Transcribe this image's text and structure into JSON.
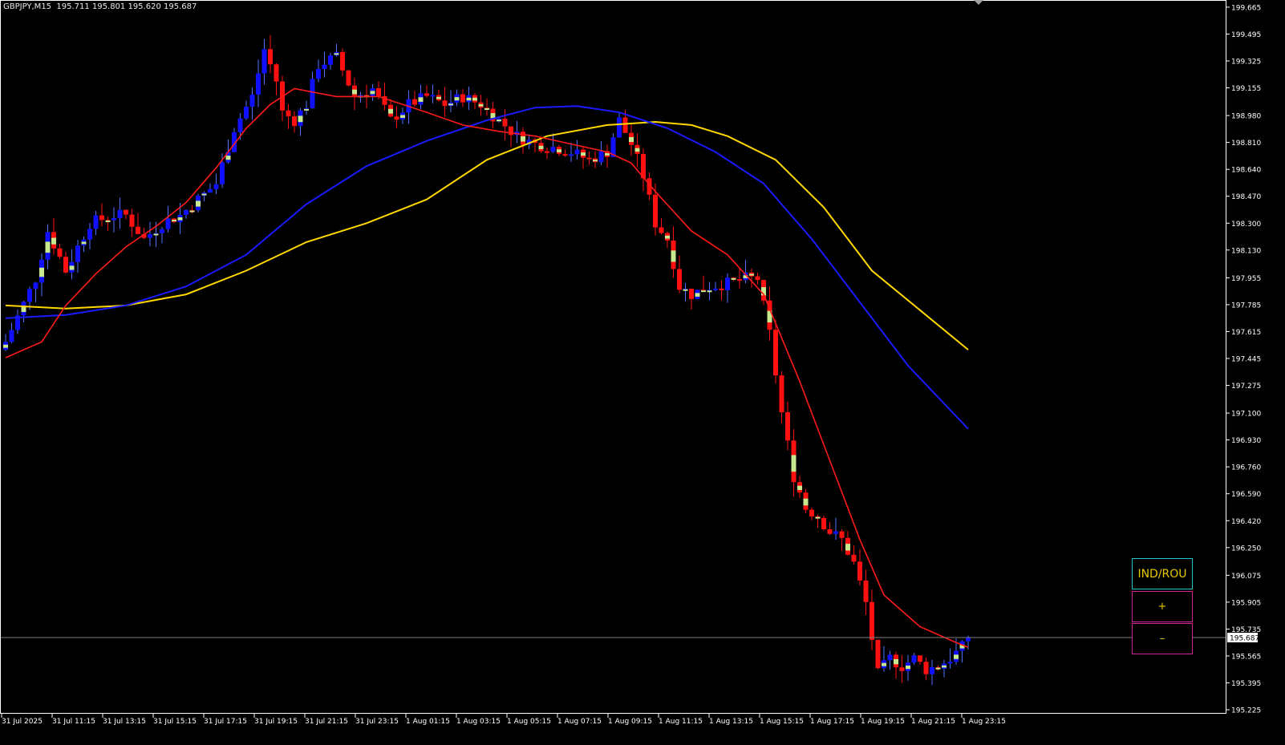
{
  "header": {
    "symbol_info": "GBPJPY,M15  195.711 195.801 195.620 195.687"
  },
  "panel": {
    "ind_label": "IND/ROU",
    "plus_label": "+",
    "minus_label": "–"
  },
  "colors": {
    "background": "#000000",
    "bull": "#1010ff",
    "bear": "#ff1010",
    "doji": "#c8e890",
    "wick": "#4a70ff",
    "ma_fast": "#ff1a1a",
    "ma_mid": "#1a1aff",
    "ma_slow": "#ffd800",
    "axis": "#ffffff",
    "price_line": "#808080"
  },
  "chart_data": {
    "type": "candlestick",
    "symbol": "GBPJPY",
    "timeframe": "M15",
    "ylim": [
      195.2,
      199.7
    ],
    "y_ticks": [
      "199.665",
      "199.495",
      "199.325",
      "199.155",
      "198.980",
      "198.810",
      "198.640",
      "198.470",
      "198.300",
      "198.130",
      "197.955",
      "197.785",
      "197.615",
      "197.445",
      "197.275",
      "197.100",
      "196.930",
      "196.760",
      "196.590",
      "196.420",
      "196.250",
      "196.075",
      "195.905",
      "195.735",
      "195.565",
      "195.395",
      "195.225"
    ],
    "x_ticks": [
      "31 Jul 2025",
      "31 Jul 11:15",
      "31 Jul 13:15",
      "31 Jul 15:15",
      "31 Jul 17:15",
      "31 Jul 19:15",
      "31 Jul 21:15",
      "31 Jul 23:15",
      "1 Aug 01:15",
      "1 Aug 03:15",
      "1 Aug 05:15",
      "1 Aug 07:15",
      "1 Aug 09:15",
      "1 Aug 11:15",
      "1 Aug 13:15",
      "1 Aug 15:15",
      "1 Aug 17:15",
      "1 Aug 19:15",
      "1 Aug 21:15",
      "1 Aug 23:15"
    ],
    "current_price": "195.687",
    "close_path": [
      [
        0,
        197.55
      ],
      [
        5,
        197.95
      ],
      [
        7,
        198.25
      ],
      [
        10,
        198.0
      ],
      [
        14,
        198.3
      ],
      [
        18,
        198.35
      ],
      [
        20,
        198.35
      ],
      [
        23,
        198.2
      ],
      [
        26,
        198.3
      ],
      [
        29,
        198.35
      ],
      [
        32,
        198.45
      ],
      [
        35,
        198.55
      ],
      [
        38,
        198.9
      ],
      [
        41,
        199.1
      ],
      [
        43,
        199.4
      ],
      [
        45,
        199.2
      ],
      [
        46,
        199.0
      ],
      [
        48,
        198.95
      ],
      [
        50,
        199.05
      ],
      [
        52,
        199.3
      ],
      [
        55,
        199.35
      ],
      [
        58,
        199.1
      ],
      [
        61,
        199.15
      ],
      [
        64,
        198.95
      ],
      [
        67,
        199.05
      ],
      [
        70,
        199.1
      ],
      [
        73,
        199.05
      ],
      [
        76,
        199.1
      ],
      [
        79,
        199.05
      ],
      [
        82,
        198.95
      ],
      [
        85,
        198.85
      ],
      [
        88,
        198.8
      ],
      [
        91,
        198.78
      ],
      [
        94,
        198.75
      ],
      [
        97,
        198.7
      ],
      [
        100,
        198.75
      ],
      [
        102,
        198.95
      ],
      [
        104,
        198.8
      ],
      [
        106,
        198.6
      ],
      [
        108,
        198.3
      ],
      [
        110,
        198.2
      ],
      [
        112,
        197.9
      ],
      [
        114,
        197.85
      ],
      [
        117,
        197.9
      ],
      [
        120,
        197.92
      ],
      [
        123,
        197.95
      ],
      [
        125,
        197.95
      ],
      [
        127,
        197.6
      ],
      [
        129,
        197.1
      ],
      [
        131,
        196.7
      ],
      [
        133,
        196.5
      ],
      [
        135,
        196.45
      ],
      [
        137,
        196.35
      ],
      [
        139,
        196.3
      ],
      [
        141,
        196.15
      ],
      [
        143,
        195.9
      ],
      [
        145,
        195.45
      ],
      [
        147,
        195.55
      ],
      [
        149,
        195.5
      ],
      [
        151,
        195.55
      ],
      [
        153,
        195.48
      ],
      [
        155,
        195.5
      ],
      [
        157,
        195.55
      ],
      [
        159,
        195.62
      ],
      [
        160,
        195.69
      ]
    ],
    "ma_fast_path": [
      [
        0,
        197.45
      ],
      [
        6,
        197.55
      ],
      [
        10,
        197.78
      ],
      [
        15,
        197.98
      ],
      [
        20,
        198.15
      ],
      [
        25,
        198.28
      ],
      [
        30,
        198.43
      ],
      [
        35,
        198.65
      ],
      [
        40,
        198.9
      ],
      [
        44,
        199.05
      ],
      [
        48,
        199.15
      ],
      [
        55,
        199.1
      ],
      [
        62,
        199.1
      ],
      [
        70,
        199.0
      ],
      [
        76,
        198.92
      ],
      [
        82,
        198.88
      ],
      [
        88,
        198.85
      ],
      [
        94,
        198.8
      ],
      [
        100,
        198.75
      ],
      [
        104,
        198.68
      ],
      [
        108,
        198.5
      ],
      [
        114,
        198.25
      ],
      [
        120,
        198.1
      ],
      [
        126,
        197.85
      ],
      [
        132,
        197.3
      ],
      [
        138,
        196.7
      ],
      [
        142,
        196.3
      ],
      [
        146,
        195.95
      ],
      [
        152,
        195.75
      ],
      [
        158,
        195.65
      ],
      [
        160,
        195.62
      ]
    ],
    "ma_mid_path": [
      [
        0,
        197.7
      ],
      [
        10,
        197.72
      ],
      [
        20,
        197.78
      ],
      [
        30,
        197.9
      ],
      [
        40,
        198.1
      ],
      [
        50,
        198.42
      ],
      [
        60,
        198.66
      ],
      [
        70,
        198.82
      ],
      [
        80,
        198.95
      ],
      [
        88,
        199.03
      ],
      [
        95,
        199.04
      ],
      [
        102,
        199.0
      ],
      [
        110,
        198.9
      ],
      [
        118,
        198.75
      ],
      [
        126,
        198.55
      ],
      [
        134,
        198.2
      ],
      [
        142,
        197.8
      ],
      [
        150,
        197.4
      ],
      [
        160,
        197.0
      ]
    ],
    "ma_slow_path": [
      [
        0,
        197.78
      ],
      [
        10,
        197.76
      ],
      [
        20,
        197.78
      ],
      [
        30,
        197.85
      ],
      [
        40,
        198.0
      ],
      [
        50,
        198.18
      ],
      [
        60,
        198.3
      ],
      [
        70,
        198.45
      ],
      [
        80,
        198.7
      ],
      [
        90,
        198.85
      ],
      [
        100,
        198.92
      ],
      [
        108,
        198.94
      ],
      [
        114,
        198.92
      ],
      [
        120,
        198.85
      ],
      [
        128,
        198.7
      ],
      [
        136,
        198.4
      ],
      [
        144,
        198.0
      ],
      [
        152,
        197.75
      ],
      [
        160,
        197.5
      ]
    ]
  }
}
